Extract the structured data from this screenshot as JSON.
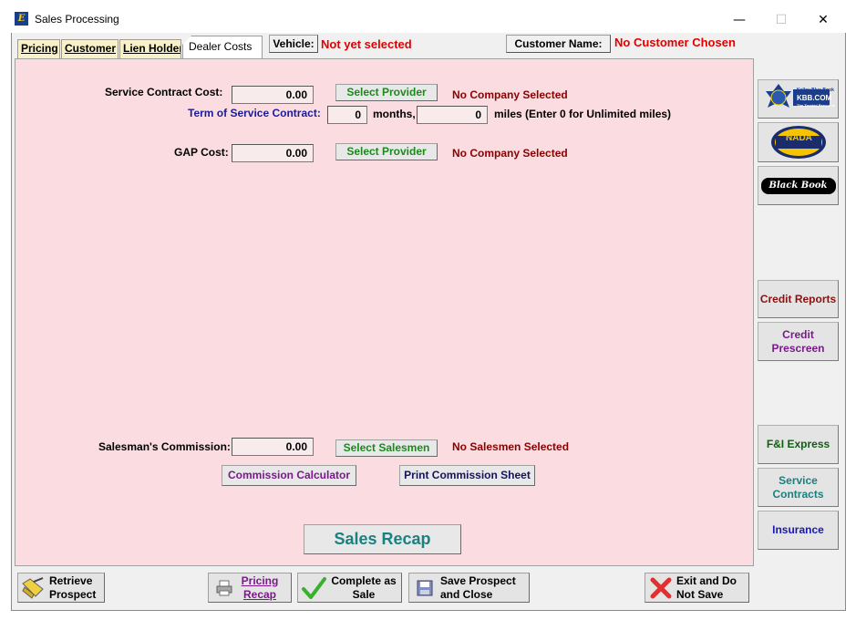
{
  "window": {
    "title": "Sales Processing",
    "minimize": "—",
    "maximize": "☐",
    "close": "✕"
  },
  "tabs": [
    {
      "label": "Pricing"
    },
    {
      "label": "Customer"
    },
    {
      "label": "Lien Holder"
    },
    {
      "label": "Dealer Costs"
    }
  ],
  "header": {
    "vehicle_label": "Vehicle:",
    "vehicle_value": "Not yet selected",
    "customer_label": "Customer Name:",
    "customer_value": "No Customer Chosen"
  },
  "service_contract": {
    "label": "Service Contract Cost:",
    "value": "0.00",
    "select_label": "Select Provider",
    "company": "No Company Selected",
    "term_label": "Term of Service Contract:",
    "months_value": "0",
    "months_label": "months,",
    "miles_value": "0",
    "miles_label": "miles (Enter 0 for Unlimited miles)"
  },
  "gap": {
    "label": "GAP Cost:",
    "value": "0.00",
    "select_label": "Select Provider",
    "company": "No Company Selected"
  },
  "commission": {
    "label": "Salesman's Commission:",
    "value": "0.00",
    "select_label": "Select Salesmen",
    "salesmen": "No Salesmen Selected",
    "calculator_label": "Commission Calculator",
    "print_label": "Print Commission Sheet"
  },
  "recap_label": "Sales Recap",
  "side": {
    "kbb_text": "KBB.COM",
    "kbb_small": "Kelley Blue Book",
    "kbb_tag": "The Trusted Resource",
    "nada_text": "NADA",
    "blackbook_text": "Black Book",
    "credit_reports": "Credit Reports",
    "credit_prescreen": "Credit Prescreen",
    "fi_express": "F&I Express",
    "service_contracts": "Service Contracts",
    "insurance": "Insurance"
  },
  "bottom": {
    "retrieve": "Retrieve Prospect",
    "pricing_recap": "Pricing Recap",
    "complete_sale": "Complete as Sale",
    "save_close": "Save Prospect and Close",
    "exit_nosave": "Exit and Do Not Save"
  },
  "colors": {
    "panel_bg": "#fbdde1",
    "tab_bg": "#f8f0c8",
    "alert_red": "#e00000",
    "status_darkred": "#8a0000"
  }
}
